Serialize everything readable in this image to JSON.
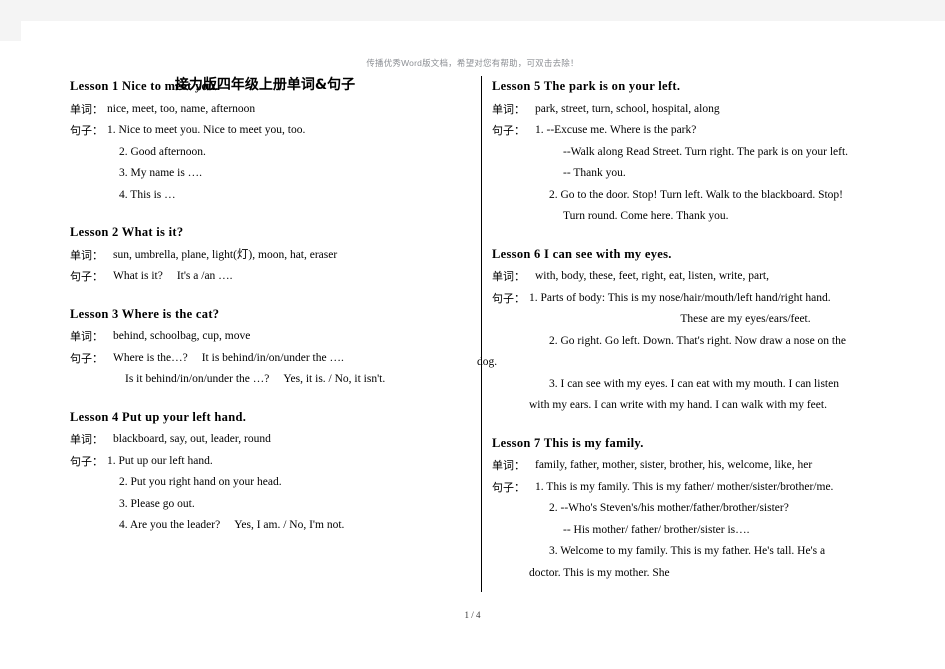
{
  "header": {
    "watermark": "传播优秀Word版文档，希望对您有帮助，可双击去除！"
  },
  "document": {
    "title": "接力版四年级上册单词&句子",
    "labels": {
      "words": "单词：",
      "sentences": "句子："
    }
  },
  "footer": {
    "page_indicator": "1 / 4"
  },
  "left_column": {
    "lessons": [
      {
        "title": "Lesson 1 Nice to meet you.",
        "words": "nice, meet, too, name, afternoon",
        "sentences": [
          "1. Nice to meet you. Nice to meet you, too.",
          "2. Good afternoon.",
          "3. My name is ….",
          "4. This is …"
        ]
      },
      {
        "title": "Lesson 2 What is it?",
        "words": "sun, umbrella, plane, light(灯), moon, hat, eraser",
        "sentences": [
          "What is it?",
          "It's a /an …."
        ]
      },
      {
        "title": "Lesson 3 Where is the cat?",
        "words": "behind, schoolbag, cup, move",
        "sentences": [
          "Where is the…?",
          "It is behind/in/on/under the ….",
          "Is it behind/in/on/under the …?",
          "Yes, it is. / No, it isn't."
        ]
      },
      {
        "title": "Lesson 4 Put up your left hand.",
        "words": "blackboard, say, out, leader, round",
        "sentences": [
          "1. Put up our left hand.",
          "2. Put you right hand on your head.",
          "3. Please go out.",
          "4. Are you the leader?",
          "Yes, I am. / No, I'm not."
        ]
      }
    ]
  },
  "right_column": {
    "lessons": [
      {
        "title": "Lesson 5 The park is on your left.",
        "words": "park, street, turn, school, hospital, along",
        "sentences": [
          "1. --Excuse me. Where is the park?",
          "--Walk along Read Street. Turn right. The park is on your left.",
          "-- Thank you.",
          "2. Go to the door. Stop! Turn left. Walk to the blackboard. Stop!",
          "Turn round. Come here. Thank you."
        ]
      },
      {
        "title": "Lesson 6 I can see with my eyes.",
        "words": "with, body, these, feet, right, eat, listen, write, part,",
        "sentences": [
          "1. Parts of body: This is my nose/hair/mouth/left hand/right hand.",
          "These are my eyes/ears/feet.",
          "2. Go right. Go left. Down. That's right. Now draw a nose on the",
          "dog.",
          "3. I can see with my eyes. I can eat with my mouth. I can listen",
          "with my ears. I can write with my hand. I can walk with my feet."
        ]
      },
      {
        "title": "Lesson 7 This is my family.",
        "words": "family, father, mother, sister, brother, his, welcome, like, her",
        "sentences": [
          "1. This is my family. This is my father/ mother/sister/brother/me.",
          "2. --Who's Steven's/his mother/father/brother/sister?",
          "-- His mother/ father/ brother/sister is….",
          "3. Welcome to my family. This is my father. He's tall. He's a",
          "doctor. This is my mother. She"
        ]
      }
    ]
  }
}
